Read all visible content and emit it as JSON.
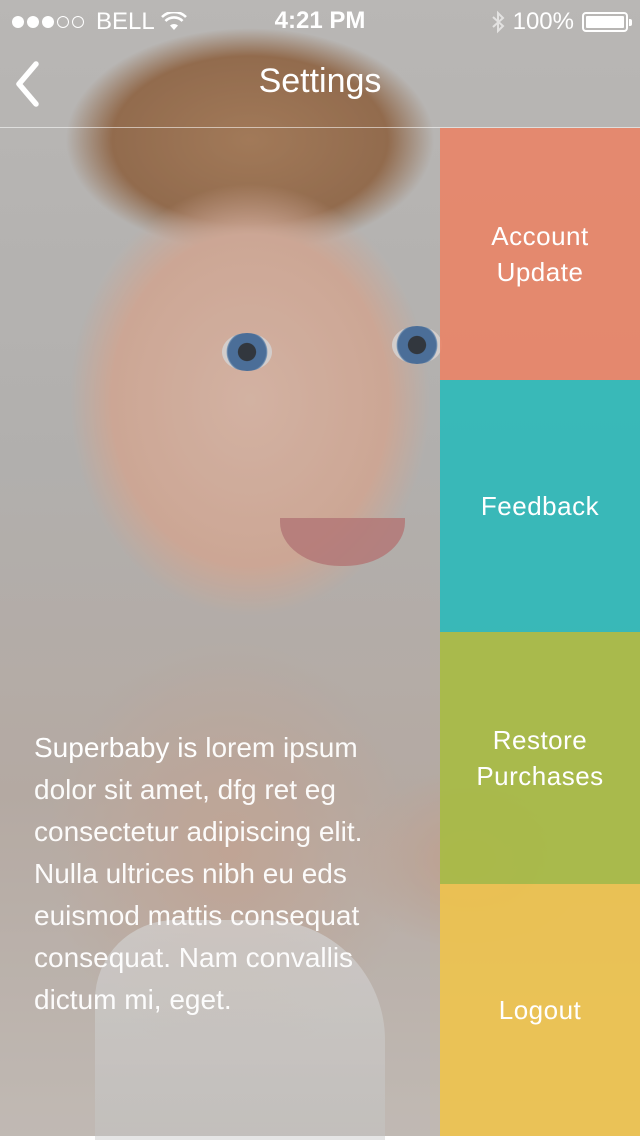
{
  "status_bar": {
    "signal_dots_filled": 3,
    "signal_dots_total": 5,
    "carrier": "BELL",
    "time": "4:21 PM",
    "battery": "100%",
    "battery_level": 1.0,
    "icons": [
      "wifi-icon",
      "bluetooth-icon",
      "battery-icon"
    ]
  },
  "nav": {
    "title": "Settings",
    "back_icon": "chevron-left-icon"
  },
  "tiles": [
    {
      "label": "Account\nUpdate",
      "color": "#e98467"
    },
    {
      "label": "Feedback",
      "color": "#28b9b9"
    },
    {
      "label": "Restore\nPurchases",
      "color": "#a7bb43"
    },
    {
      "label": "Logout",
      "color": "#eec34d"
    }
  ],
  "description": {
    "brand": "Superbaby is",
    "body": " lorem ipsum dolor sit amet, dfg ret eg consectetur adipiscing elit. Nulla ultrices nibh eu eds euismod mattis consequat consequat. Nam convallis dictum mi, eget."
  }
}
